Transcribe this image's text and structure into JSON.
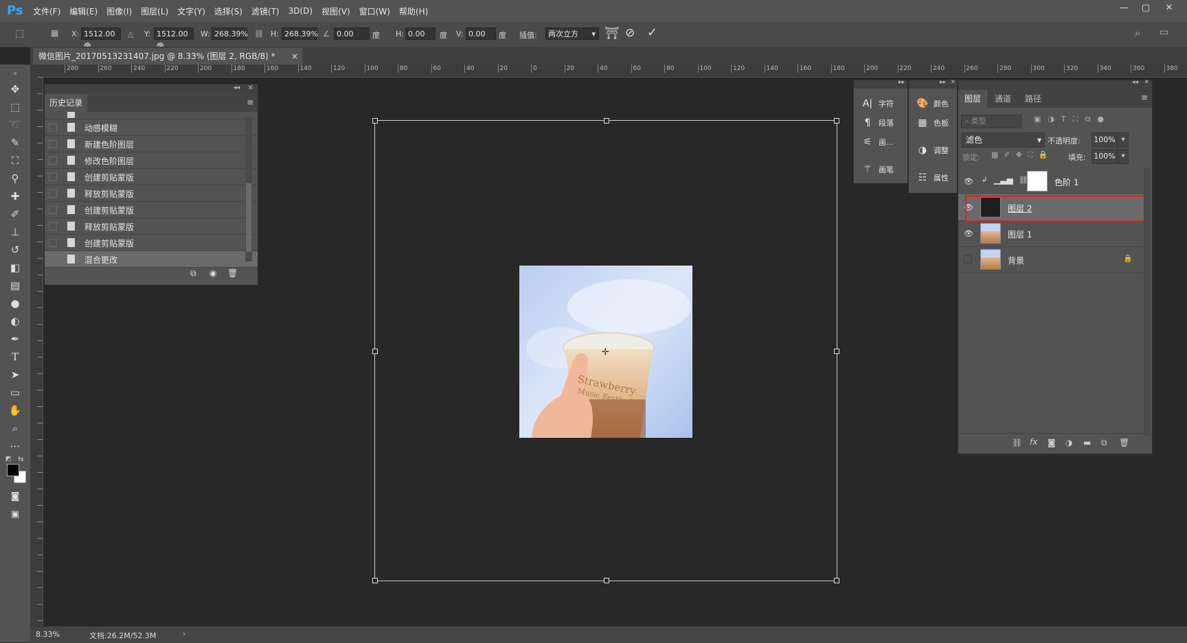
{
  "app": {
    "logo": "Ps",
    "menus": [
      "文件(F)",
      "编辑(E)",
      "图像(I)",
      "图层(L)",
      "文字(Y)",
      "选择(S)",
      "滤镜(T)",
      "3D(D)",
      "视图(V)",
      "窗口(W)",
      "帮助(H)"
    ]
  },
  "options": {
    "x_label": "X:",
    "x_value": "1512.00 像",
    "y_label": "Y:",
    "y_value": "1512.00 像",
    "w_label": "W:",
    "w_value": "268.39%",
    "h_label": "H:",
    "h_value": "268.39%",
    "angle_value": "0.00",
    "angle_unit": "度",
    "hskew_label": "H:",
    "hskew_value": "0.00",
    "hskew_unit": "度",
    "vskew_label": "V:",
    "vskew_value": "0.00",
    "vskew_unit": "度",
    "interp_label": "插值:",
    "interp_value": "两次立方"
  },
  "document": {
    "tab_title": "微信图片_20170513231407.jpg @ 8.33% (图层 2, RGB/8) *",
    "close": "×"
  },
  "rulers": {
    "h_ticks": [
      "280",
      "260",
      "240",
      "220",
      "200",
      "180",
      "160",
      "140",
      "120",
      "100",
      "80",
      "60",
      "40",
      "20",
      "0",
      "20",
      "40",
      "60",
      "80",
      "100",
      "120",
      "140",
      "160",
      "180",
      "200",
      "220",
      "240",
      "260",
      "280",
      "300",
      "320",
      "340",
      "360",
      "380"
    ]
  },
  "history": {
    "title": "历史记录",
    "items": [
      {
        "label": "动感模糊",
        "selected": false
      },
      {
        "label": "新建色阶图层",
        "selected": false
      },
      {
        "label": "修改色阶图层",
        "selected": false
      },
      {
        "label": "创建剪贴蒙版",
        "selected": false
      },
      {
        "label": "释放剪贴蒙版",
        "selected": false
      },
      {
        "label": "创建剪贴蒙版",
        "selected": false
      },
      {
        "label": "释放剪贴蒙版",
        "selected": false
      },
      {
        "label": "创建剪贴蒙版",
        "selected": false
      },
      {
        "label": "混合更改",
        "selected": true
      }
    ]
  },
  "strip1": {
    "items": [
      "字符",
      "段落",
      "画...",
      "画笔"
    ]
  },
  "strip2": {
    "items": [
      "颜色",
      "色板",
      "调整",
      "属性"
    ]
  },
  "layers_panel": {
    "tabs": [
      "图层",
      "通道",
      "路径"
    ],
    "filter_placeholder": "类型",
    "blend_mode": "滤色",
    "opacity_label": "不透明度:",
    "opacity_value": "100%",
    "lock_label": "锁定:",
    "fill_label": "填充:",
    "fill_value": "100%",
    "layers": [
      {
        "name": "色阶 1",
        "visible": true,
        "selected": false,
        "locked": false
      },
      {
        "name": "图层 2",
        "visible": true,
        "selected": true,
        "locked": false
      },
      {
        "name": "图层 1",
        "visible": true,
        "selected": false,
        "locked": false
      },
      {
        "name": "背景",
        "visible": false,
        "selected": false,
        "locked": true
      }
    ]
  },
  "status": {
    "zoom": "8.33%",
    "doc_info": "文档:26.2M/52.3M",
    "arrow": "›"
  },
  "photo": {
    "cup_text_1": "Strawberry",
    "cup_text_2": "Music Festival"
  },
  "colors": {
    "accent": "#31a8ff",
    "selection_border": "#e02020",
    "panel_bg": "#535353",
    "canvas_bg": "#282828"
  }
}
